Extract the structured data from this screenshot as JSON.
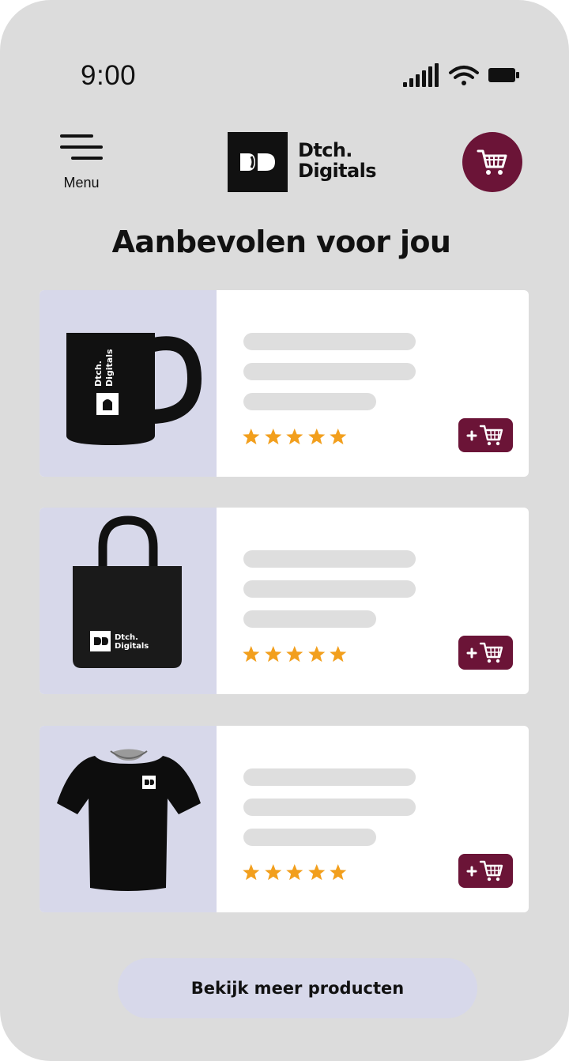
{
  "status_bar": {
    "time": "9:00",
    "icons": [
      "signal-icon",
      "wifi-icon",
      "battery-icon"
    ]
  },
  "header": {
    "menu_label": "Menu",
    "logo_line1": "Dtch.",
    "logo_line2": "Digitals",
    "cart_icon": "shopping-cart-icon"
  },
  "title": "Aanbevolen voor jou",
  "products": [
    {
      "image": "mug-icon",
      "rating": 5
    },
    {
      "image": "tote-bag-icon",
      "rating": 5
    },
    {
      "image": "t-shirt-icon",
      "rating": 5
    }
  ],
  "more_button": "Bekijk meer producten",
  "colors": {
    "background": "#dcdcdc",
    "accent": "#6b1437",
    "image_panel": "#d7d8ea",
    "star": "#f29f1d",
    "placeholder_bar": "#dedede",
    "text": "#111111"
  }
}
